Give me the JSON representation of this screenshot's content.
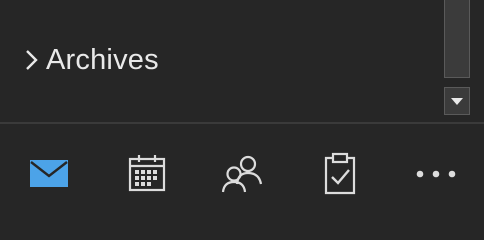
{
  "folders": {
    "items": [
      {
        "label": "Archives",
        "icon": "chevron-right-icon"
      }
    ]
  },
  "nav": {
    "items": [
      {
        "name": "mail",
        "icon": "mail-icon",
        "active": true
      },
      {
        "name": "calendar",
        "icon": "calendar-icon",
        "active": false
      },
      {
        "name": "people",
        "icon": "people-icon",
        "active": false
      },
      {
        "name": "tasks",
        "icon": "tasks-icon",
        "active": false
      },
      {
        "name": "more",
        "icon": "more-icon",
        "active": false
      }
    ]
  },
  "colors": {
    "background": "#262626",
    "text": "#e9e9e9",
    "accent": "#4ca3e8",
    "icon": "#dcdcdc"
  }
}
